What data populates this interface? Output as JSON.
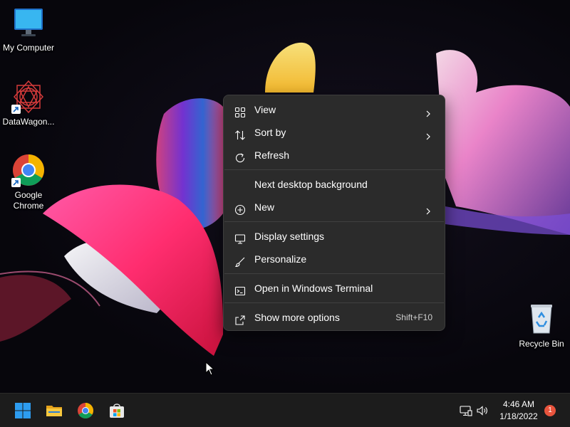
{
  "desktop": {
    "icons": [
      {
        "label": "My Computer",
        "icon": "monitor-icon"
      },
      {
        "label": "DataWagon...",
        "icon": "datawagon-logo-icon"
      },
      {
        "label": "Google\nChrome",
        "icon": "chrome-icon"
      },
      {
        "label": "Recycle Bin",
        "icon": "recycle-bin-icon"
      }
    ]
  },
  "context_menu": {
    "items": [
      {
        "label": "View",
        "icon": "grid-icon",
        "submenu": true
      },
      {
        "label": "Sort by",
        "icon": "sort-icon",
        "submenu": true
      },
      {
        "label": "Refresh",
        "icon": "refresh-icon"
      },
      {
        "label": "Next desktop background",
        "icon": ""
      },
      {
        "label": "New",
        "icon": "plus-circle-icon",
        "submenu": true
      },
      {
        "label": "Display settings",
        "icon": "display-icon"
      },
      {
        "label": "Personalize",
        "icon": "brush-icon"
      },
      {
        "label": "Open in Windows Terminal",
        "icon": "terminal-icon"
      },
      {
        "label": "Show more options",
        "icon": "share-icon",
        "shortcut": "Shift+F10"
      }
    ]
  },
  "taskbar": {
    "buttons": [
      {
        "name": "start",
        "icon": "windows-logo-icon"
      },
      {
        "name": "file-explorer",
        "icon": "folder-icon"
      },
      {
        "name": "chrome",
        "icon": "chrome-icon"
      },
      {
        "name": "store",
        "icon": "store-icon"
      }
    ],
    "tray": {
      "network_icon": "network-icon",
      "volume_icon": "volume-icon",
      "time": "4:46 AM",
      "date": "1/18/2022",
      "notification_count": "1"
    }
  },
  "colors": {
    "menu_bg": "#2b2b2b",
    "taskbar_bg": "#1c1c1c",
    "wallpaper_pink": "#ff2d6f",
    "wallpaper_yellow": "#f7cf4e",
    "notification_badge": "#e8543d"
  }
}
